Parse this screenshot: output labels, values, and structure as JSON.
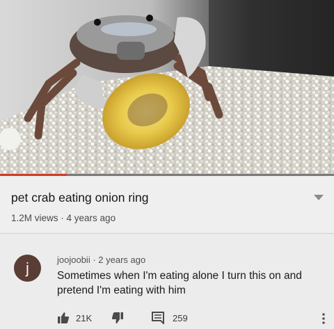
{
  "video": {
    "title": "pet crab eating onion ring",
    "views": "1.2M views",
    "age": "4 years ago",
    "progress_fraction": 0.2,
    "colors": {
      "progress": "#d23a2a",
      "track": "#7a7a7a"
    }
  },
  "icons": {
    "expand": "chevron-down-icon",
    "like": "thumbs-up-icon",
    "dislike": "thumbs-down-icon",
    "replies": "comment-icon",
    "more": "more-vertical-icon"
  },
  "comment": {
    "avatar_letter": "j",
    "avatar_color": "#5a3d35",
    "author": "joojoobii",
    "age": "2 years ago",
    "text_lines": [
      "Sometimes when I'm eating alone I turn this on and",
      "pretend I'm eating with him"
    ],
    "likes": "21K",
    "replies": "259"
  }
}
